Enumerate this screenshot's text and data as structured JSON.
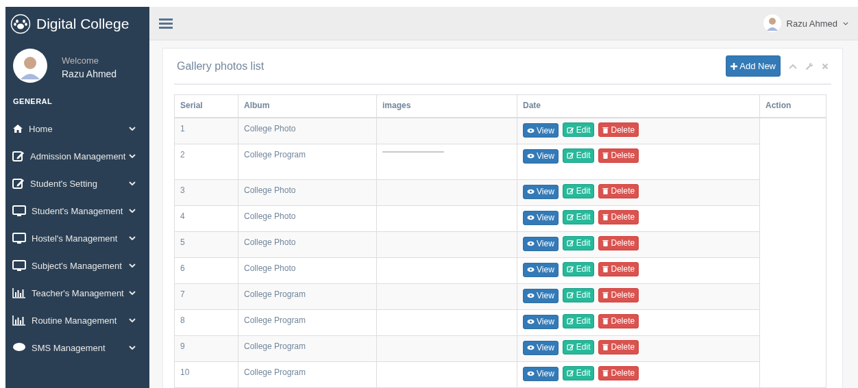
{
  "sidebar": {
    "brand": "Digital College",
    "welcome": "Welcome",
    "user": "Razu Ahmed",
    "section": "GENERAL",
    "items": [
      {
        "label": "Home",
        "kind": "home"
      },
      {
        "label": "Admission Management",
        "kind": "edit"
      },
      {
        "label": "Student's Setting",
        "kind": "edit"
      },
      {
        "label": "Student's Management",
        "kind": "monitor"
      },
      {
        "label": "Hostel's Management",
        "kind": "monitor"
      },
      {
        "label": "Subject's Management",
        "kind": "monitor"
      },
      {
        "label": "Teacher's Management",
        "kind": "chart"
      },
      {
        "label": "Routine Management",
        "kind": "chart"
      },
      {
        "label": "SMS Management",
        "kind": "chat"
      }
    ]
  },
  "topbar": {
    "user": "Razu Ahmed"
  },
  "panel": {
    "title": "Gallery photos list",
    "add_button": "Add New",
    "table": {
      "columns": [
        "Serial",
        "Album",
        "images",
        "Date",
        "Action"
      ],
      "rows": [
        {
          "serial": "1",
          "album": "College Photo",
          "has_image": false,
          "actions": [
            "View",
            "Edit",
            "Delete"
          ]
        },
        {
          "serial": "2",
          "album": "College Program",
          "has_image": true,
          "actions": [
            "View",
            "Edit",
            "Delete"
          ]
        },
        {
          "serial": "3",
          "album": "College Photo",
          "has_image": false,
          "actions": [
            "View",
            "Edit",
            "Delete"
          ]
        },
        {
          "serial": "4",
          "album": "College Photo",
          "has_image": false,
          "actions": [
            "View",
            "Edit",
            "Delete"
          ]
        },
        {
          "serial": "5",
          "album": "College Photo",
          "has_image": false,
          "actions": [
            "View",
            "Edit",
            "Delete"
          ]
        },
        {
          "serial": "6",
          "album": "College Photo",
          "has_image": false,
          "actions": [
            "View",
            "Edit",
            "Delete"
          ]
        },
        {
          "serial": "7",
          "album": "College Program",
          "has_image": false,
          "actions": [
            "View",
            "Edit",
            "Delete"
          ]
        },
        {
          "serial": "8",
          "album": "College Program",
          "has_image": false,
          "actions": [
            "View",
            "Edit",
            "Delete"
          ]
        },
        {
          "serial": "9",
          "album": "College Program",
          "has_image": false,
          "actions": [
            "View",
            "Edit",
            "Delete"
          ]
        },
        {
          "serial": "10",
          "album": "College Program",
          "has_image": false,
          "actions": [
            "View",
            "Edit",
            "Delete"
          ]
        }
      ]
    }
  }
}
